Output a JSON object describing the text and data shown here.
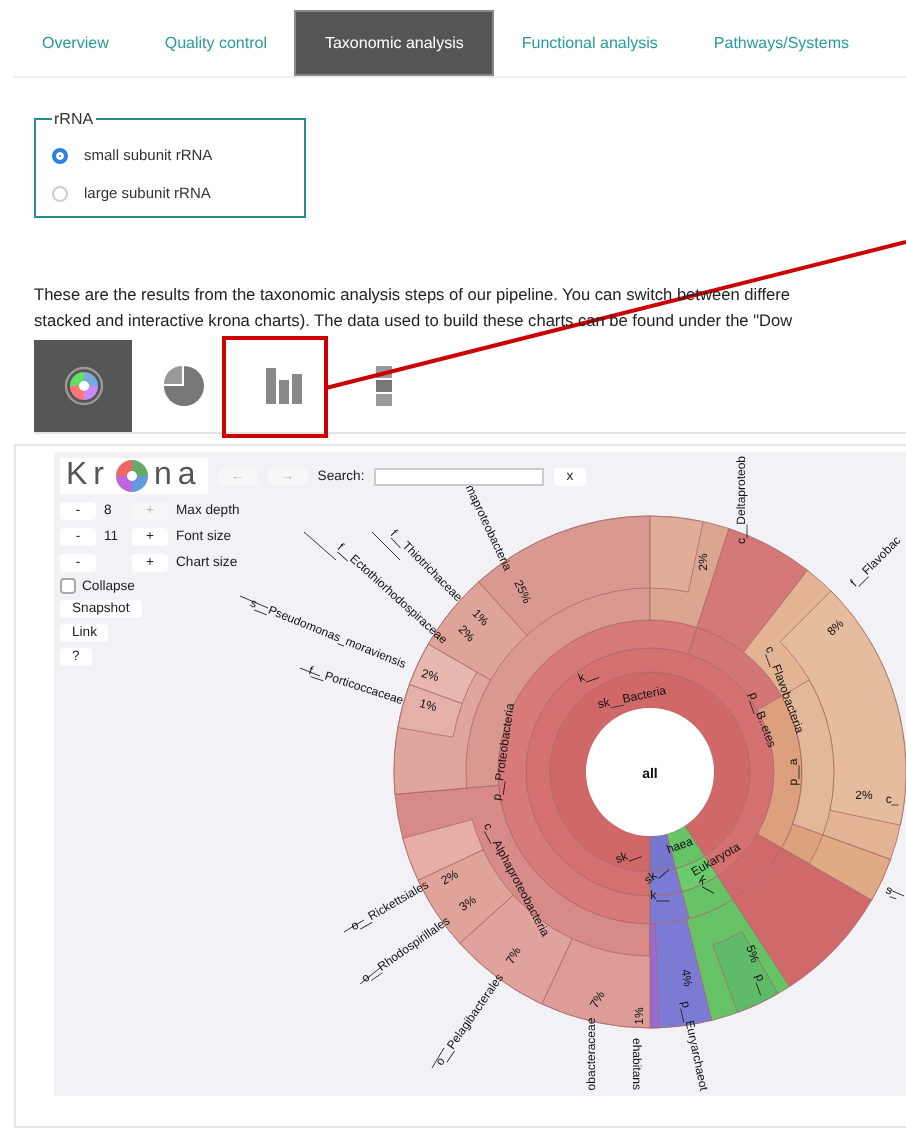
{
  "tabs": [
    {
      "label": "Overview",
      "selected": false
    },
    {
      "label": "Quality control",
      "selected": false
    },
    {
      "label": "Taxonomic analysis",
      "selected": true
    },
    {
      "label": "Functional analysis",
      "selected": false
    },
    {
      "label": "Pathways/Systems",
      "selected": false
    }
  ],
  "rrna": {
    "legend": "rRNA",
    "options": [
      {
        "label": "small subunit rRNA",
        "selected": true
      },
      {
        "label": "large subunit rRNA",
        "selected": false
      }
    ]
  },
  "description": [
    "These are the results from the taxonomic analysis steps of our pipeline. You can switch between differe",
    "stacked and interactive krona charts). The data used to build these charts can be found under the \"Dow"
  ],
  "view_buttons": [
    {
      "kind": "krona",
      "selected": true,
      "highlighted": false
    },
    {
      "kind": "pie",
      "selected": false,
      "highlighted": false
    },
    {
      "kind": "bar",
      "selected": false,
      "highlighted": true
    },
    {
      "kind": "stacked",
      "selected": false,
      "highlighted": false
    }
  ],
  "krona": {
    "logo_left": "Kr",
    "logo_right": "na",
    "nav": [
      {
        "text": "←",
        "disabled": true
      },
      {
        "text": "→",
        "disabled": true
      }
    ],
    "search_label": "Search:",
    "clear": "x",
    "controls": [
      {
        "minus": "-",
        "value": "8",
        "plus": "+",
        "label": "Max depth",
        "plus_disabled": true
      },
      {
        "minus": "-",
        "value": "11",
        "plus": "+",
        "label": "Font size",
        "plus_disabled": false
      },
      {
        "minus": "-",
        "plus": "+",
        "label": "Chart size",
        "plus_disabled": false
      }
    ],
    "collapse": {
      "label": "Collapse",
      "checked": false
    },
    "buttons": [
      "Snapshot",
      "Link",
      "?"
    ],
    "labels": [
      {
        "text": "all",
        "kind": "center"
      },
      {
        "text": "sk__Bacteria",
        "kind": "taxon"
      },
      {
        "text": "k__",
        "kind": "taxon"
      },
      {
        "text": "p__Proteobacteria",
        "kind": "taxon"
      },
      {
        "text": "c__Alphaproteobacteria",
        "kind": "taxon"
      },
      {
        "text": "o__Rickettsiales",
        "kind": "taxon"
      },
      {
        "text": "o__Rhodospirillales",
        "kind": "taxon"
      },
      {
        "text": "o__Pelagibacterales",
        "kind": "taxon"
      },
      {
        "text": "obacteraceae",
        "kind": "taxon"
      },
      {
        "text": "ehabitans",
        "kind": "taxon"
      },
      {
        "text": "p__Euryarchaeot",
        "kind": "taxon"
      },
      {
        "text": "sk__",
        "kind": "taxon"
      },
      {
        "text": "haea",
        "kind": "taxon"
      },
      {
        "text": "Eukaryota",
        "kind": "taxon"
      },
      {
        "text": "sk__",
        "kind": "taxon"
      },
      {
        "text": "k__",
        "kind": "taxon"
      },
      {
        "text": "k__",
        "kind": "taxon"
      },
      {
        "text": "p__",
        "kind": "taxon"
      },
      {
        "text": "s_",
        "kind": "taxon"
      },
      {
        "text": "c_",
        "kind": "taxon"
      },
      {
        "text": "p__a",
        "kind": "taxon"
      },
      {
        "text": "p__B..etes",
        "kind": "taxon"
      },
      {
        "text": "c__Flavobacteria",
        "kind": "taxon"
      },
      {
        "text": "f__Flavobac",
        "kind": "taxon"
      },
      {
        "text": "c__Deltaproteob",
        "kind": "taxon"
      },
      {
        "text": "maproteobacteria",
        "kind": "taxon"
      },
      {
        "text": "f__Thiotrichaceae",
        "kind": "taxon"
      },
      {
        "text": "f__Ectothiorhodospiraceae",
        "kind": "taxon"
      },
      {
        "text": "s__Pseudomonas_moraviensis",
        "kind": "taxon"
      },
      {
        "text": "f__Porticoccaceae",
        "kind": "taxon"
      },
      {
        "text": "25%",
        "kind": "percent"
      },
      {
        "text": "2%",
        "kind": "percent"
      },
      {
        "text": "8%",
        "kind": "percent"
      },
      {
        "text": "1%",
        "kind": "percent"
      },
      {
        "text": "2%",
        "kind": "percent"
      },
      {
        "text": "2%",
        "kind": "percent"
      },
      {
        "text": "1%",
        "kind": "percent"
      },
      {
        "text": "2%",
        "kind": "percent"
      },
      {
        "text": "2%",
        "kind": "percent"
      },
      {
        "text": "3%",
        "kind": "percent"
      },
      {
        "text": "7%",
        "kind": "percent"
      },
      {
        "text": "7%",
        "kind": "percent"
      },
      {
        "text": "1%",
        "kind": "percent"
      },
      {
        "text": "4%",
        "kind": "percent"
      },
      {
        "text": "5%",
        "kind": "percent"
      }
    ]
  }
}
